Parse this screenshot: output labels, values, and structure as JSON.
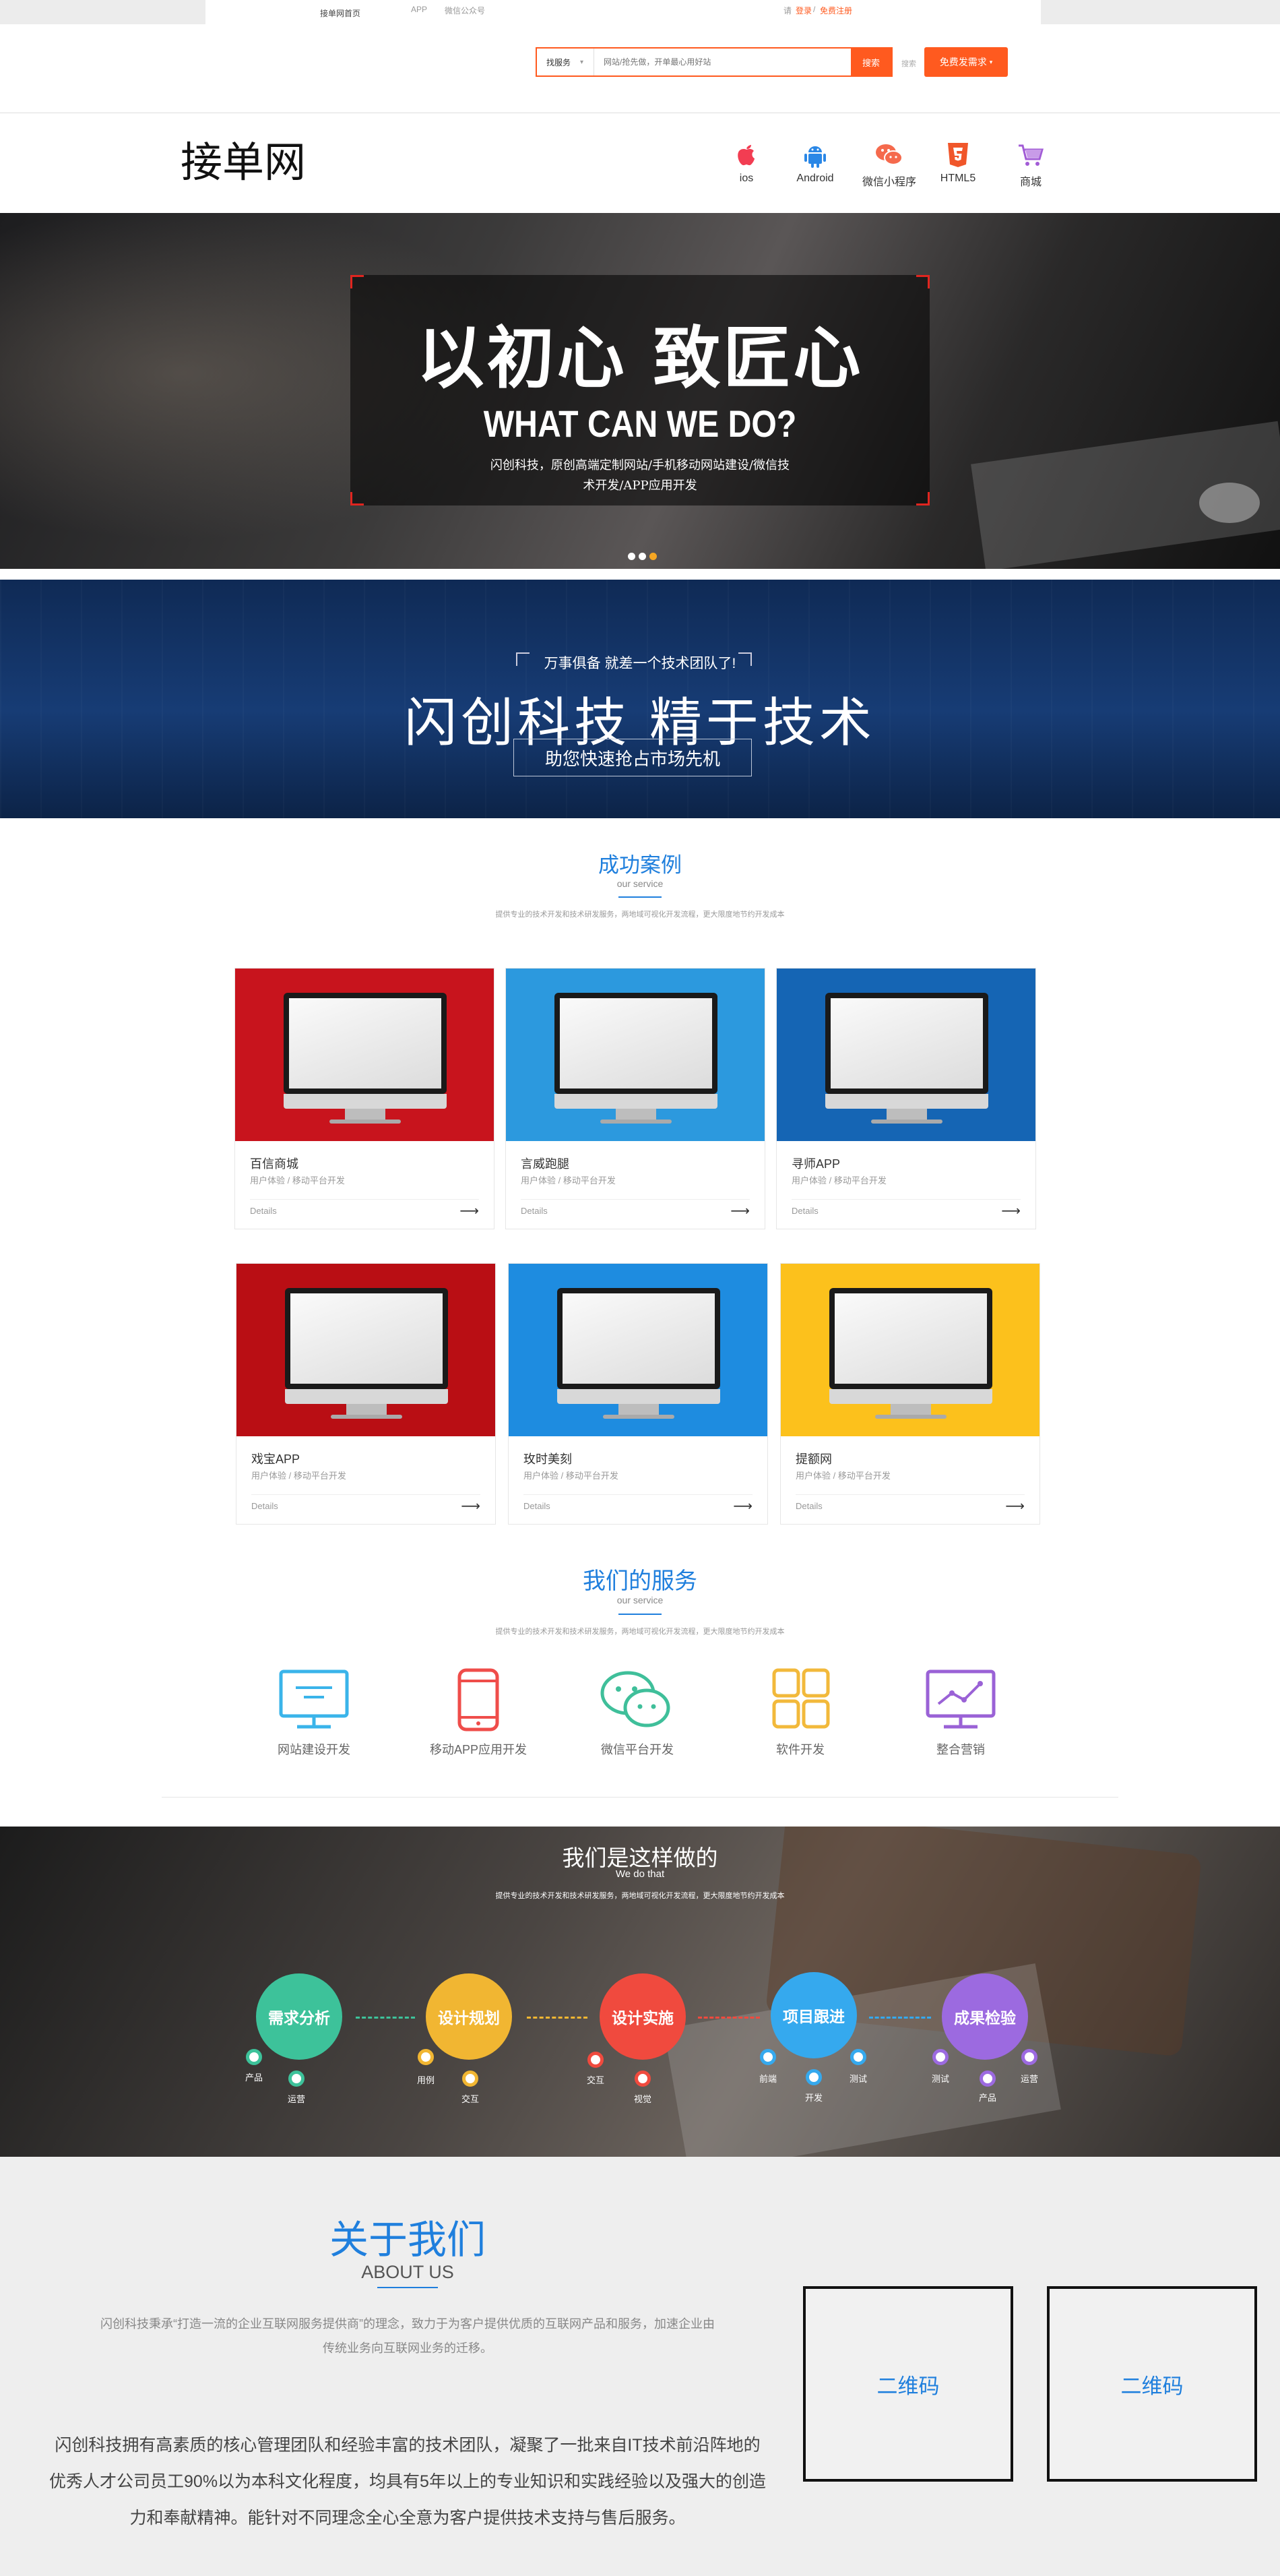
{
  "topbar": {
    "left_link": "接单网首页",
    "app_link": "APP",
    "wechat_link": "微信公众号",
    "greeting": "请",
    "login": "登录",
    "sep": "/",
    "register": "免费注册"
  },
  "search": {
    "category": "找服务",
    "placeholder": "网站/抢先做，开单最心用好站",
    "button": "搜索",
    "small_link": "搜索",
    "post_button": "免费发需求"
  },
  "nav": {
    "logo": "接单网",
    "items": [
      {
        "label": "ios"
      },
      {
        "label": "Android"
      },
      {
        "label": "微信小程序"
      },
      {
        "label": "HTML5"
      },
      {
        "label": "商城"
      }
    ]
  },
  "banner1": {
    "title_cn": "以初心 致匠心",
    "title_en": "WHAT CAN WE DO?",
    "line1": "闪创科技，原创高端定制网站/手机移动网站建设/微信技",
    "line2": "术开发/APP应用开发"
  },
  "banner2": {
    "tagline": "万事俱备 就差一个技术团队了!",
    "headline": "闪创科技  精于技术",
    "subline": "助您快速抢占市场先机"
  },
  "cases": {
    "title": "成功案例",
    "subtitle": "our service",
    "desc": "提供专业的技术开发和技术研发服务，两地域可视化开发流程，更大限度地节约开发成本",
    "items": [
      {
        "name": "百信商城",
        "desc": "用户体验 / 移动平台开发",
        "more": "Details",
        "color": "#c8141d"
      },
      {
        "name": "言威跑腿",
        "desc": "用户体验 / 移动平台开发",
        "more": "Details",
        "color": "#2c99de"
      },
      {
        "name": "寻师APP",
        "desc": "用户体验 / 移动平台开发",
        "more": "Details",
        "color": "#1565b4"
      },
      {
        "name": "戏宝APP",
        "desc": "用户体验 / 移动平台开发",
        "more": "Details",
        "color": "#b90e14"
      },
      {
        "name": "玫时美刻",
        "desc": "用户体验 / 移动平台开发",
        "more": "Details",
        "color": "#1e8ce0"
      },
      {
        "name": "提额网",
        "desc": "用户体验 / 移动平台开发",
        "more": "Details",
        "color": "#fcc11c"
      }
    ]
  },
  "services": {
    "title": "我们的服务",
    "subtitle": "our service",
    "desc": "提供专业的技术开发和技术研发服务，两地域可视化开发流程，更大限度地节约开发成本",
    "items": [
      {
        "label": "网站建设开发"
      },
      {
        "label": "移动APP应用开发"
      },
      {
        "label": "微信平台开发"
      },
      {
        "label": "软件开发"
      },
      {
        "label": "整合营销"
      }
    ]
  },
  "process": {
    "title": "我们是这样做的",
    "subtitle": "We do that",
    "desc": "提供专业的技术开发和技术研发服务，两地域可视化开发流程，更大限度地节约开发成本",
    "steps": [
      {
        "label": "需求分析",
        "color": "#3dc29a",
        "dots": [
          "产品",
          "运营"
        ]
      },
      {
        "label": "设计规划",
        "color": "#f1b632",
        "dots": [
          "用例",
          "交互"
        ]
      },
      {
        "label": "设计实施",
        "color": "#f04a3e",
        "dots": [
          "交互",
          "视觉"
        ]
      },
      {
        "label": "项目跟进",
        "color": "#35a9ee",
        "dots": [
          "前端",
          "开发",
          "测试"
        ]
      },
      {
        "label": "成果检验",
        "color": "#9c6ae0",
        "dots": [
          "测试",
          "产品",
          "运营"
        ]
      }
    ]
  },
  "about": {
    "title": "关于我们",
    "subtitle": "ABOUT US",
    "intro1": "闪创科技秉承“打造一流的企业互联网服务提供商”的理念，致力于为客户提供优质的互联网产品和服务，加速企业由",
    "intro2": "传统业务向互联网业务的迁移。",
    "body1": "闪创科技拥有高素质的核心管理团队和经验丰富的技术团队，凝聚了一批来自IT技术前沿阵地的",
    "body2": "优秀人才公司员工90%以为本科文化程度，均具有5年以上的专业知识和实践经验以及强大的创造",
    "body3": "力和奉献精神。能针对不同理念全心全意为客户提供技术支持与售后服务。",
    "qr1": "二维码",
    "qr2": "二维码"
  },
  "colors": {
    "accent": "#ff5a1f",
    "blue": "#1f7fdd"
  }
}
